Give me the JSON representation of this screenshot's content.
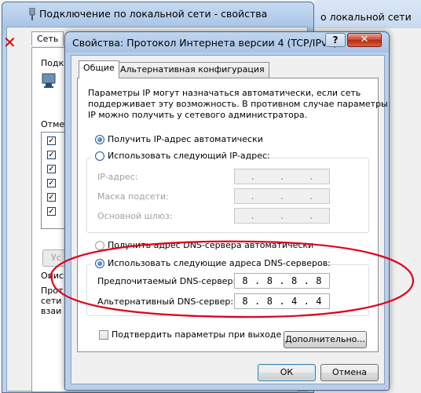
{
  "background": {
    "back_window_title": "Подключение по локальной сети - свойства",
    "right_window_title": "о локальной сети",
    "back_tab": "Сеть",
    "back_label_connect": "Подкл",
    "back_label_components": "Отмеч",
    "back_button": "Ус",
    "back_group_label": "Опис",
    "back_group_line1": "Прот",
    "back_group_line2": "сети",
    "back_group_line3": "взаи"
  },
  "dialog": {
    "title": "Свойства: Протокол Интернета версии 4 (TCP/IPv4)",
    "help_button": "?",
    "close_button": "✕",
    "tabs": [
      "Общие",
      "Альтернативная конфигурация"
    ],
    "description": [
      "Параметры IP могут назначаться автоматически, если сеть",
      "поддерживает эту возможность. В противном случае параметры",
      "IP можно получить у сетевого администратора."
    ],
    "ip": {
      "auto_label": "Получить IP-адрес автоматически",
      "manual_label": "Использовать следующий IP-адрес:",
      "address_label": "IP-адрес:",
      "mask_label": "Маска подсети:",
      "gateway_label": "Основной шлюз:"
    },
    "dns": {
      "auto_label": "Получить адрес DNS-сервера автоматически",
      "manual_label": "Использовать следующие адреса DNS-серверов:",
      "preferred_label": "Предпочитаемый DNS-сервер:",
      "preferred_octets": [
        "8",
        "8",
        "8",
        "8"
      ],
      "alternate_label": "Альтернативный DNS-сервер:",
      "alternate_octets": [
        "8",
        "8",
        "4",
        "4"
      ]
    },
    "validate_label": "Подтвердить параметры при выходе",
    "advanced_button": "Дополнительно...",
    "ok_button": "ОК",
    "cancel_button": "Отмена"
  },
  "colors": {
    "highlight_ellipse": "#e0001a",
    "title_bar": "#b8cfeb",
    "close_button": "#c9422b"
  }
}
